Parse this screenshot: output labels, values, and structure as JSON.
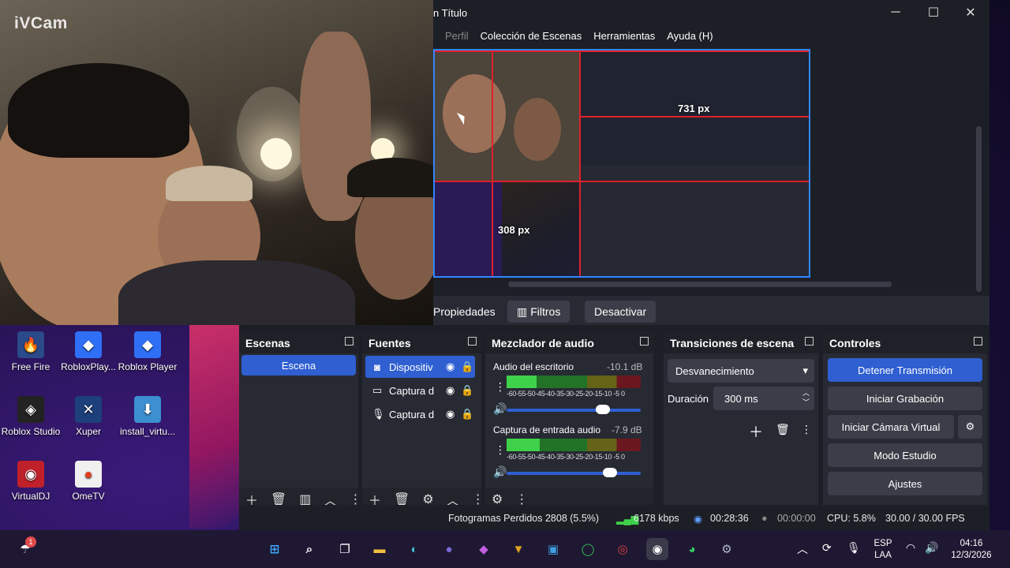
{
  "webcam": {
    "brand": "iVCam"
  },
  "obs": {
    "title": "n Título",
    "window_controls": {
      "minimize": "─",
      "maximize": "☐",
      "close": "✕"
    },
    "menu": [
      "Perfil",
      "Colección de Escenas",
      "Herramientas",
      "Ayuda (H)"
    ],
    "preview": {
      "label_width": "731 px",
      "label_height": "308 px"
    },
    "toolbar": {
      "properties": "Propiedades",
      "filters": "Filtros",
      "deactivate": "Desactivar"
    },
    "docks": {
      "scenes": {
        "title": "Escenas",
        "items": [
          "Escena"
        ]
      },
      "sources": {
        "title": "Fuentes",
        "items": [
          "Dispositiv",
          "Captura d",
          "Captura d"
        ]
      },
      "mixer": {
        "title": "Mezclador de audio",
        "channels": [
          {
            "name": "Audio del escritorio",
            "level": "-10.1 dB",
            "ticks": "-60-55-50-45-40-35-30-25-20-15-10 -5  0",
            "volume": 0.72
          },
          {
            "name": "Captura de entrada audio",
            "level": "-7.9 dB",
            "ticks": "-60-55-50-45-40-35-30-25-20-15-10 -5  0",
            "volume": 0.77
          }
        ]
      },
      "transitions": {
        "title": "Transiciones de escena",
        "selected": "Desvanecimiento",
        "duration_label": "Duración",
        "duration_value": "300 ms"
      },
      "controls": {
        "title": "Controles",
        "stop_stream": "Detener Transmisión",
        "start_recording": "Iniciar Grabación",
        "virtual_camera": "Iniciar Cámara Virtual",
        "studio_mode": "Modo Estudio",
        "settings": "Ajustes"
      }
    },
    "status": {
      "dropped_frames": "Fotogramas Perdidos 2808 (5.5%)",
      "bitrate": "6178 kbps",
      "stream_time": "00:28:36",
      "rec_time": "00:00:00",
      "cpu": "CPU: 5.8%",
      "fps": "30.00 / 30.00 FPS"
    }
  },
  "desktop_icons": [
    {
      "label": "Free Fire",
      "icon": "freefire-icon",
      "color": "#2a4a8a"
    },
    {
      "label": "RobloxPlay...",
      "icon": "roblox-icon",
      "color": "#2f6ff5"
    },
    {
      "label": "Roblox Player",
      "icon": "roblox-icon",
      "color": "#2f6ff5"
    },
    {
      "label": "Roblox Studio",
      "icon": "roblox-studio-icon",
      "color": "#222"
    },
    {
      "label": "Xuper",
      "icon": "xuper-icon",
      "color": "#1d3f7a"
    },
    {
      "label": "install_virtu...",
      "icon": "installer-icon",
      "color": "#3c8fd1"
    },
    {
      "label": "VirtualDJ",
      "icon": "virtualdj-icon",
      "color": "#c0202a"
    },
    {
      "label": "OmeTV",
      "icon": "ometv-icon",
      "color": "#f0f0f0"
    }
  ],
  "taskbar": {
    "weather_badge": "1",
    "lang_top": "ESP",
    "lang_bottom": "LAA",
    "time": "04:16",
    "date": "12/3/2026"
  }
}
